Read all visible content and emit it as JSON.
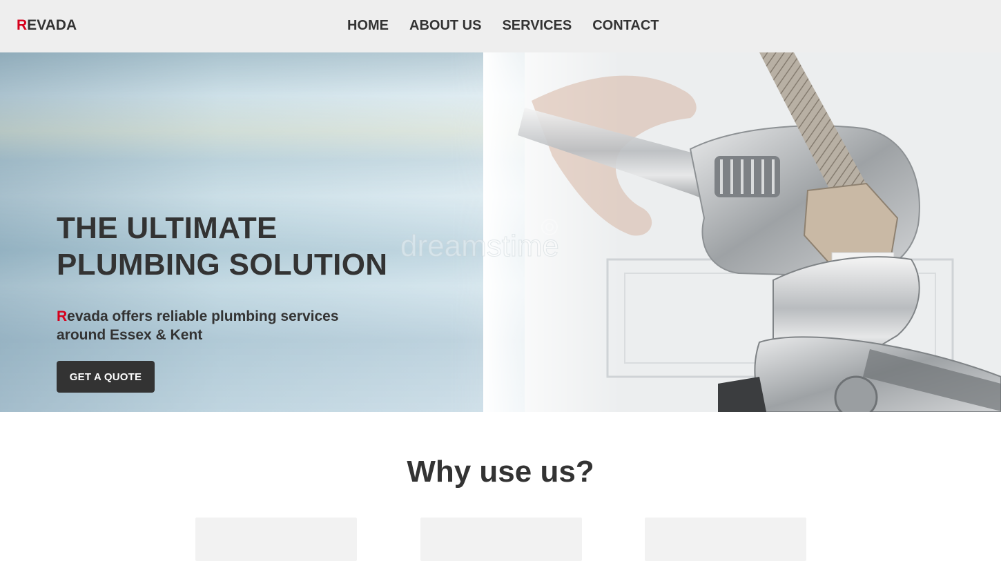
{
  "header": {
    "logo_first_letter": "R",
    "logo_rest": "EVADA",
    "nav": [
      {
        "label": "HOME"
      },
      {
        "label": "ABOUT US"
      },
      {
        "label": "SERVICES"
      },
      {
        "label": "CONTACT"
      }
    ]
  },
  "hero": {
    "title_line1": "THE ULTIMATE",
    "title_line2": "PLUMBING SOLUTION",
    "subtitle_first_letter": "R",
    "subtitle_line1_rest": "evada offers reliable plumbing services",
    "subtitle_line2": "around Essex & Kent",
    "cta_label": "GET A QUOTE",
    "image_subject": "wrenches-on-pipe-fitting"
  },
  "why": {
    "title": "Why use us?",
    "cards": [
      {
        "id": "card-1"
      },
      {
        "id": "card-2"
      },
      {
        "id": "card-3"
      }
    ]
  },
  "colors": {
    "accent": "#d6001c",
    "text": "#333333",
    "nav_bg": "#eeeeee",
    "button_bg": "#333333",
    "card_bg": "#f2f2f2"
  }
}
